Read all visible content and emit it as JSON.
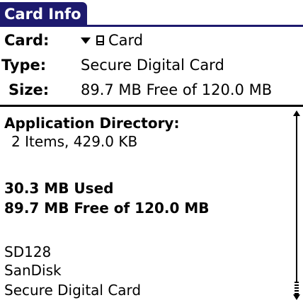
{
  "title": "Card Info",
  "info": {
    "card_label": "Card:",
    "card_value": "Card",
    "type_label": "Type:",
    "type_value": "Secure Digital Card",
    "size_label": "Size:",
    "size_value": "89.7 MB Free of 120.0 MB"
  },
  "details": {
    "app_dir_heading": "Application Directory:",
    "app_dir_summary": "2 Items, 429.0 KB",
    "used": "30.3 MB Used",
    "free_of_total": "89.7 MB Free of 120.0 MB",
    "card_name": "SD128",
    "manufacturer": "SanDisk",
    "card_type": "Secure Digital Card"
  },
  "icons": {
    "dropdown": "triangle-down-icon",
    "card": "card-icon",
    "scroll_up": "scroll-up-arrow-icon",
    "scroll_down": "scroll-down-arrow-icon"
  },
  "colors": {
    "title_bar": "#1d1a6e",
    "title_text": "#ffffff",
    "text": "#000000",
    "background": "#ffffff"
  }
}
